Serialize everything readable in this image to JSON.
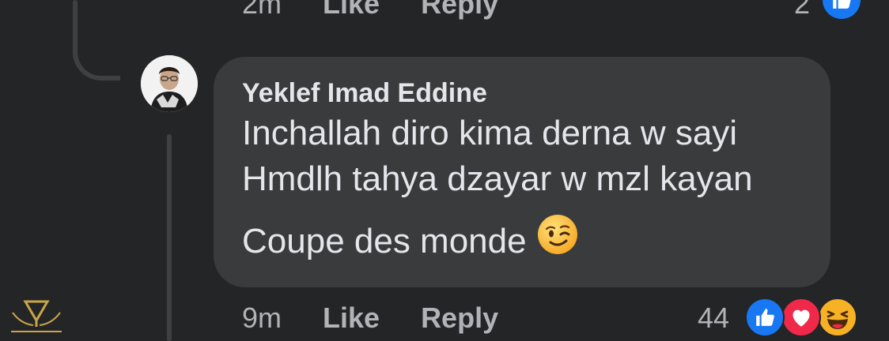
{
  "previous_comment": {
    "time": "2m",
    "like_label": "Like",
    "reply_label": "Reply",
    "reaction_count": "2"
  },
  "comment": {
    "author": "Yeklef Imad Eddine",
    "lines": [
      "Inchallah diro kima derna w sayi",
      "Hmdlh tahya dzayar w mzl kayan",
      "Coupe des monde"
    ],
    "emoji": "winking-face-emoji",
    "time": "9m",
    "like_label": "Like",
    "reply_label": "Reply",
    "reaction_count": "44",
    "reactions": [
      "like-icon",
      "love-icon",
      "haha-icon"
    ]
  },
  "colors": {
    "background": "#242526",
    "bubble": "#3a3b3c",
    "text_primary": "#e4e6eb",
    "text_secondary": "#b0b3b8",
    "like_blue": "#1877f2",
    "love_red": "#f0284a",
    "haha_yellow": "#f7b125"
  }
}
